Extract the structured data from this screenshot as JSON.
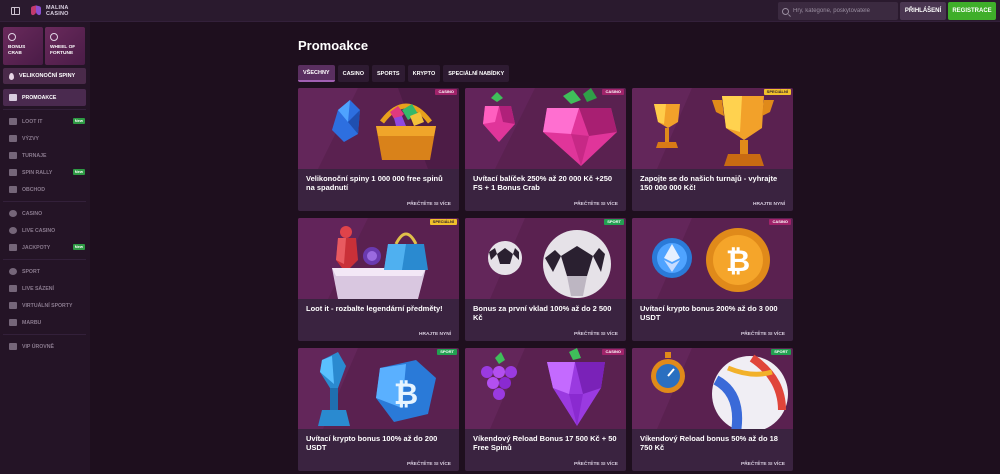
{
  "header": {
    "logo_line1": "MALINA",
    "logo_line2": "CASINO",
    "search_placeholder": "Hry, kategorie, poskytovatelé",
    "login_label": "PŘIHLÁŠENÍ",
    "register_label": "REGISTRACE"
  },
  "sidebar": {
    "tiles": [
      {
        "line1": "BONUS",
        "line2": "CRAB"
      },
      {
        "line1": "WHEEL OF",
        "line2": "FORTUNE"
      }
    ],
    "easter_label": "VELIKONOČNÍ SPINY",
    "items": [
      {
        "label": "PROMOAKCE"
      },
      {
        "label": "LOOT IT",
        "badge": "New"
      },
      {
        "label": "VÝZVY"
      },
      {
        "label": "TURNAJE"
      },
      {
        "label": "SPIN RALLY",
        "badge": "New"
      },
      {
        "label": "OBCHOD"
      },
      {
        "label": "CASINO"
      },
      {
        "label": "LIVE CASINO"
      },
      {
        "label": "JACKPOTY",
        "badge": "New"
      },
      {
        "label": "SPORT"
      },
      {
        "label": "LIVE SÁZENÍ"
      },
      {
        "label": "VIRTUÁLNÍ SPORTY"
      },
      {
        "label": "MARBU"
      },
      {
        "label": "VIP ÚROVNĚ"
      }
    ]
  },
  "main": {
    "title": "Promoakce",
    "tabs": [
      "VŠECHNY",
      "CASINO",
      "SPORTS",
      "KRYPTO",
      "SPECIÁLNÍ NABÍDKY"
    ],
    "cards": [
      {
        "tag": "CASINO",
        "title": "Velikonoční spiny 1 000 000 free spinů na spadnutí",
        "link": "PŘEČTĚTE SI VÍCE"
      },
      {
        "tag": "CASINO",
        "title": "Uvítací balíček 250% až 20 000 Kč +250 FS + 1 Bonus Crab",
        "link": "PŘEČTĚTE SI VÍCE"
      },
      {
        "tag": "SPECIÁLNÍ",
        "title": "Zapojte se do našich turnajů - vyhrajte 150 000 000 Kč!",
        "link": "HRAJTE NYNÍ"
      },
      {
        "tag": "SPECIÁLNÍ",
        "title": "Loot it - rozbalte legendární předměty!",
        "link": "HRAJTE NYNÍ"
      },
      {
        "tag": "SPORT",
        "title": "Bonus za první vklad 100% až do 2 500 Kč",
        "link": "PŘEČTĚTE SI VÍCE"
      },
      {
        "tag": "CASINO",
        "title": "Uvítací krypto bonus 200% až do 3 000 USDT",
        "link": "PŘEČTĚTE SI VÍCE"
      },
      {
        "tag": "SPORT",
        "title": "Uvítací krypto bonus 100% až do 200 USDT",
        "link": "PŘEČTĚTE SI VÍCE"
      },
      {
        "tag": "CASINO",
        "title": "Víkendový Reload Bonus 17 500 Kč + 50 Free Spinů",
        "link": "PŘEČTĚTE SI VÍCE"
      },
      {
        "tag": "SPORT",
        "title": "Víkendový Reload bonus 50% až do 18 750 Kč",
        "link": "PŘEČTĚTE SI VÍCE"
      }
    ]
  },
  "colors": {
    "background": "#1e0f1e",
    "register_green": "#3fae2a",
    "tag_casino": "#a0236a",
    "tag_special": "#f1c12b",
    "tag_sport": "#22a051"
  }
}
